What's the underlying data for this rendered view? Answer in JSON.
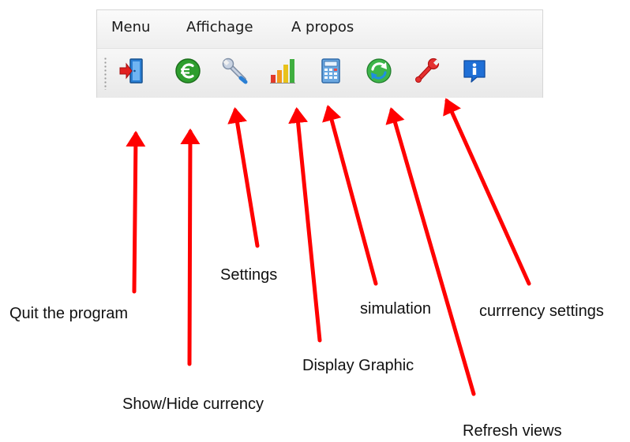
{
  "menubar": {
    "items": [
      {
        "label": "Menu"
      },
      {
        "label": "Affichage"
      },
      {
        "label": "A propos"
      }
    ]
  },
  "toolbar": {
    "buttons": [
      {
        "icon": "exit-door-icon"
      },
      {
        "icon": "euro-icon"
      },
      {
        "icon": "wrench-icon"
      },
      {
        "icon": "bar-chart-icon"
      },
      {
        "icon": "calculator-icon"
      },
      {
        "icon": "refresh-icon"
      },
      {
        "icon": "red-wrench-icon"
      },
      {
        "icon": "info-icon"
      }
    ]
  },
  "annotations": {
    "quit": "Quit the program",
    "show_hide_currency": "Show/Hide currency",
    "settings": "Settings",
    "display_graphic": "Display Graphic",
    "simulation": "simulation",
    "refresh_views": "Refresh views",
    "currency_settings": "currrency settings"
  },
  "colors": {
    "arrow": "#ff0000",
    "euro_green": "#2e9e2e",
    "door_blue": "#2a7fd4",
    "info_blue": "#1f6fd6"
  }
}
